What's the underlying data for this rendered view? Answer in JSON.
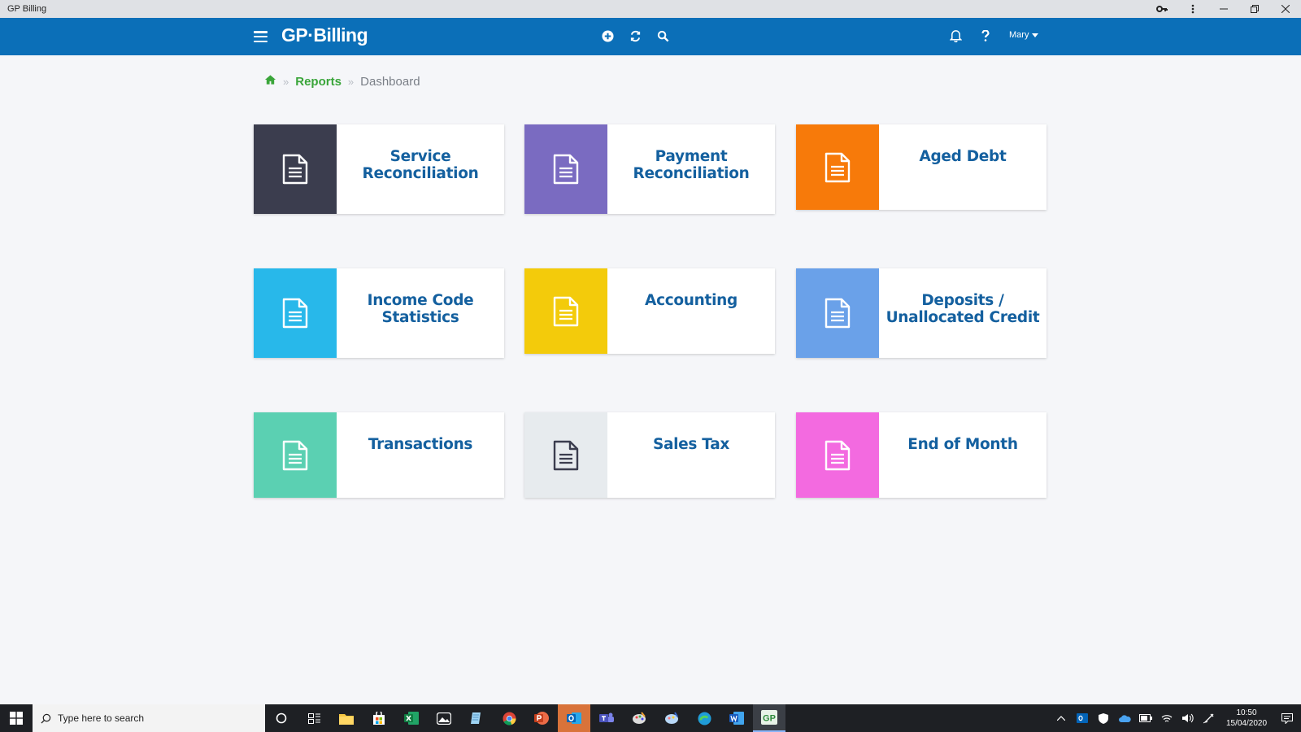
{
  "window": {
    "title": "GP Billing"
  },
  "app": {
    "logo": "GP·Billing"
  },
  "header": {
    "user": "Mary"
  },
  "breadcrumb": {
    "section": "Reports",
    "current": "Dashboard"
  },
  "cards": [
    {
      "label": "Service\nReconciliation",
      "color": "#3b3d4e"
    },
    {
      "label": "Payment\nReconciliation",
      "color": "#7a6bc1"
    },
    {
      "label": "Aged Debt",
      "color": "#f77a0a"
    },
    {
      "label": "Income Code\nStatistics",
      "color": "#28b8ea"
    },
    {
      "label": "Accounting",
      "color": "#f3cb0b"
    },
    {
      "label": "Deposits /\nUnallocated Credit",
      "color": "#6aa1e9"
    },
    {
      "label": "Transactions",
      "color": "#5bd0b2"
    },
    {
      "label": "Sales Tax",
      "color": "#e7ebee"
    },
    {
      "label": "End of Month",
      "color": "#f36ae0"
    }
  ],
  "taskbar": {
    "search_placeholder": "Type here to search",
    "time": "10:50",
    "date": "15/04/2020"
  }
}
